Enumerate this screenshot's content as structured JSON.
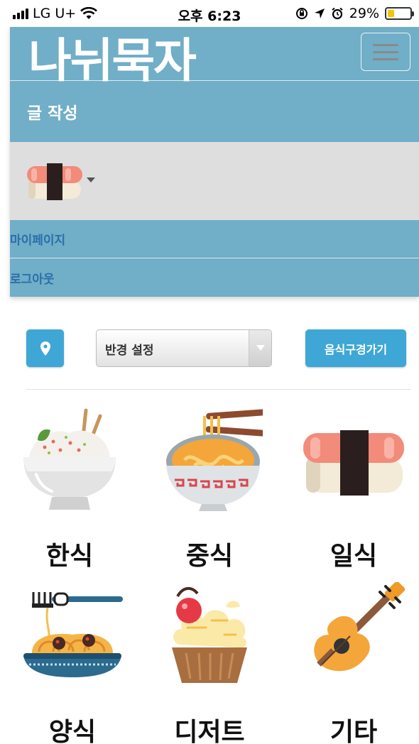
{
  "status_bar": {
    "carrier": "LG U+",
    "time": "오후 6:23",
    "battery_percent": "29%",
    "battery_level": 0.29
  },
  "navbar": {
    "brand": "나뉘묵자",
    "write_post": "글 작성",
    "mypage": "마이페이지",
    "logout": "로그아웃",
    "profile_icon": "sushi-icon"
  },
  "controls": {
    "location_icon": "map-pin-icon",
    "radius_select_value": "반경 설정",
    "look_button": "음식구경가기"
  },
  "categories": [
    {
      "label": "한식",
      "icon": "rice-bowl-icon"
    },
    {
      "label": "중식",
      "icon": "noodle-bowl-icon"
    },
    {
      "label": "일식",
      "icon": "sushi-icon"
    },
    {
      "label": "양식",
      "icon": "spaghetti-icon"
    },
    {
      "label": "디저트",
      "icon": "cupcake-icon"
    },
    {
      "label": "기타",
      "icon": "guitar-icon"
    }
  ],
  "colors": {
    "navbar": "#71aec7",
    "button": "#3fa7d6",
    "menu_link": "#2a6fab",
    "profile_band": "#dedede"
  }
}
